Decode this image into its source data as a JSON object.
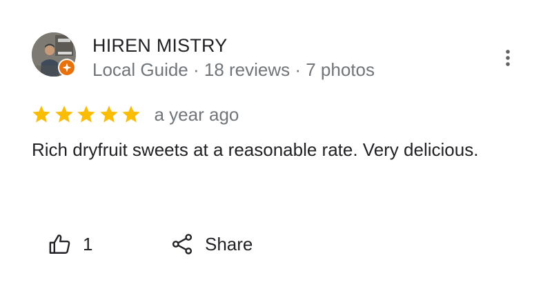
{
  "reviewer": {
    "name": "HIREN MISTRY",
    "meta": "Local Guide · 18 reviews · 7 photos",
    "badge_color": "#e8710a"
  },
  "review": {
    "rating": 5,
    "rating_max": 5,
    "time_ago": "a year ago",
    "text": "Rich dryfruit sweets at a reasonable rate. Very delicious."
  },
  "actions": {
    "like_count": "1",
    "share_label": "Share"
  },
  "colors": {
    "star": "#fbbc04",
    "primary_text": "#202124",
    "secondary_text": "#70757a"
  },
  "icons": {
    "more": "more-vert-icon",
    "like": "thumb-up-icon",
    "share": "share-icon",
    "badge": "local-guide-star-icon"
  }
}
